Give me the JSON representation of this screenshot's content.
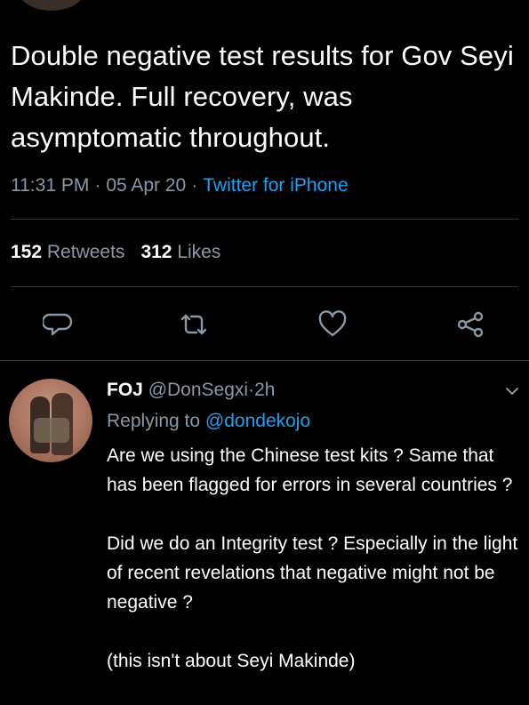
{
  "tweet": {
    "text": "Double negative test results for Gov Seyi Makinde. Full recovery, was asymptomatic throughout.",
    "time": "11:31 PM",
    "separator": "·",
    "date": "05 Apr 20",
    "source": "Twitter for iPhone",
    "retweet_count": "152",
    "retweet_label": "Retweets",
    "like_count": "312",
    "like_label": "Likes"
  },
  "actions": {
    "reply_icon": "reply-bubble-icon",
    "retweet_icon": "retweet-icon",
    "like_icon": "heart-icon",
    "share_icon": "share-icon"
  },
  "reply": {
    "name": "FOJ",
    "handle": "@DonSegxi",
    "separator": "·",
    "time": "2h",
    "replying_prefix": "Replying to",
    "replying_to": "@dondekojo",
    "paragraphs": [
      "Are we using the Chinese test kits ? Same that has been flagged for errors in several countries ?",
      "Did we do an Integrity test ? Especially in the light of recent revelations that negative might not be negative ?",
      "(this isn't about Seyi Makinde)"
    ]
  },
  "colors": {
    "background": "#000000",
    "text_primary": "#ffffff",
    "text_secondary": "#8899a6",
    "accent": "#1da1f2",
    "divider": "#2f3336"
  }
}
